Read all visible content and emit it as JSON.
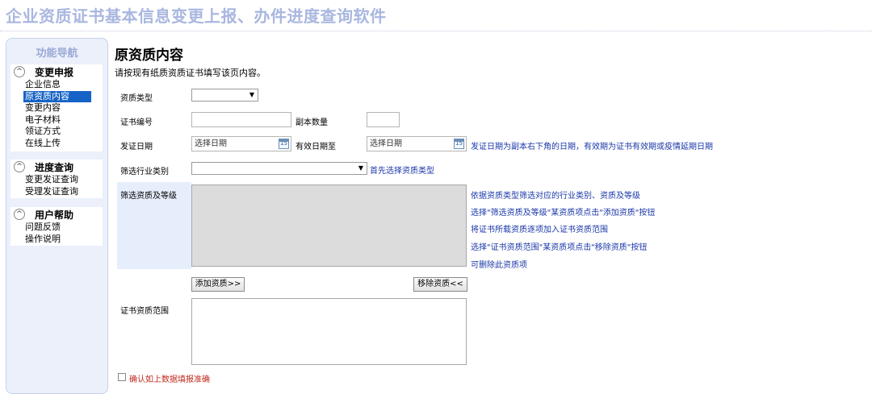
{
  "app": {
    "title": "企业资质证书基本信息变更上报、办件进度查询软件"
  },
  "sidebar": {
    "title": "功能导航",
    "groups": [
      {
        "label": "变更申报",
        "items": [
          "企业信息",
          "原资质内容",
          "变更内容",
          "电子材料",
          "领证方式",
          "在线上传"
        ]
      },
      {
        "label": "进度查询",
        "items": [
          "变更发证查询",
          "受理发证查询"
        ]
      },
      {
        "label": "用户帮助",
        "items": [
          "问题反馈",
          "操作说明"
        ]
      }
    ],
    "collapse_glyph": "^",
    "active_item": "原资质内容"
  },
  "main": {
    "title": "原资质内容",
    "desc": "请按现有纸质资质证书填写该页内容。",
    "labels": {
      "qual_type": "资质类型",
      "cert_no": "证书编号",
      "copies": "副本数量",
      "issue_date": "发证日期",
      "valid_until": "有效日期至",
      "industry": "筛选行业类别",
      "qual_level": "筛选资质及等级",
      "cert_scope": "证书资质范围"
    },
    "date_placeholder": "选择日期",
    "cal_day": "15",
    "date_hint": "发证日期为副本右下角的日期，有效期为证书有效期或疫情延期日期",
    "industry_hint": "首先选择资质类型",
    "qual_hints": [
      "依据资质类型筛选对应的行业类别、资质及等级",
      "选择\"筛选资质及等级\"某资质项点击\"添加资质\"按钮",
      "将证书所载资质逐项加入证书资质范围",
      "选择\"证书资质范围\"某资质项点击\"移除资质\"按钮",
      "可删除此资质项"
    ],
    "add_button": "添加资质>>",
    "remove_button": "移除资质<<",
    "confirm_text": "确认如上数据填报准确"
  }
}
